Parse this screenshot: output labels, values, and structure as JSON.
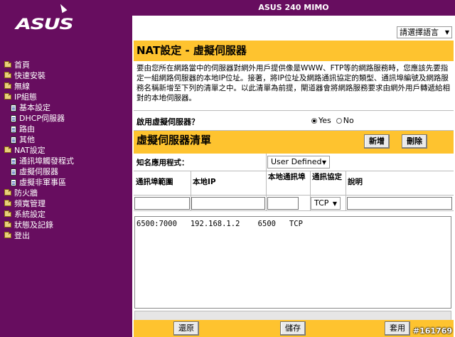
{
  "header": {
    "model": "ASUS 240 MIMO",
    "logo": "ASUS",
    "logo_mark": "®"
  },
  "language": {
    "label": "請選擇語言"
  },
  "sidebar": {
    "items": [
      {
        "label": "首頁",
        "icon": "folder-icon",
        "sub": false
      },
      {
        "label": "快速安裝",
        "icon": "folder-icon",
        "sub": false
      },
      {
        "label": "無線",
        "icon": "folder-icon",
        "sub": false
      },
      {
        "label": "IP組態",
        "icon": "folder-icon",
        "sub": false
      },
      {
        "label": "基本設定",
        "icon": "page-icon",
        "sub": true
      },
      {
        "label": "DHCP伺服器",
        "icon": "page-icon",
        "sub": true
      },
      {
        "label": "路由",
        "icon": "page-icon",
        "sub": true
      },
      {
        "label": "其他",
        "icon": "page-icon",
        "sub": true
      },
      {
        "label": "NAT設定",
        "icon": "folder-icon",
        "sub": false
      },
      {
        "label": "通訊埠觸發程式",
        "icon": "page-icon",
        "sub": true
      },
      {
        "label": "虛擬伺服器",
        "icon": "page-icon",
        "sub": true
      },
      {
        "label": "虛擬非軍事區",
        "icon": "page-icon",
        "sub": true
      },
      {
        "label": "防火牆",
        "icon": "folder-icon",
        "sub": false
      },
      {
        "label": "頻寬管理",
        "icon": "folder-icon",
        "sub": false
      },
      {
        "label": "系統設定",
        "icon": "folder-icon",
        "sub": false
      },
      {
        "label": "狀態及記錄",
        "icon": "folder-icon",
        "sub": false
      },
      {
        "label": "登出",
        "icon": "folder-icon",
        "sub": false
      }
    ]
  },
  "main": {
    "title": "NAT設定 - 虛擬伺服器",
    "description": "要由您所在網路當中的伺服器對網外用戶提供像是WWW、FTP等的網路服務時，您應該先要指定一組網路伺服器的本地IP位址。接著，將IP位址及網路通訊協定的類型、通訊埠編號及網路服務名稱新增至下列的清單之中。以此清單為前提，閘道器會將網路服務要求由網外用戶轉遞給相對的本地伺服器。",
    "enable": {
      "label": "啟用虛擬伺服器？",
      "yes": "Yes",
      "no": "No",
      "selected": "Yes"
    },
    "list": {
      "title": "虛擬伺服器清單",
      "add_label": "新增",
      "delete_label": "刪除",
      "app_label": "知名應用程式：",
      "app_value": "User Defined",
      "col_port_range": "通訊埠範圍",
      "col_local_ip": "本地IP",
      "col_local_port": "本地通訊埠",
      "col_protocol": "通訊協定",
      "col_desc": "說明",
      "protocol_value": "TCP",
      "rows": [
        "6500:7000   192.168.1.2    6500   TCP"
      ]
    },
    "footer": {
      "restore_label": "還原",
      "save_label": "儲存",
      "apply_label": "套用"
    }
  },
  "watermark": "#161769",
  "colors": {
    "purple": "#670d5f",
    "yellow": "#fec32f"
  }
}
